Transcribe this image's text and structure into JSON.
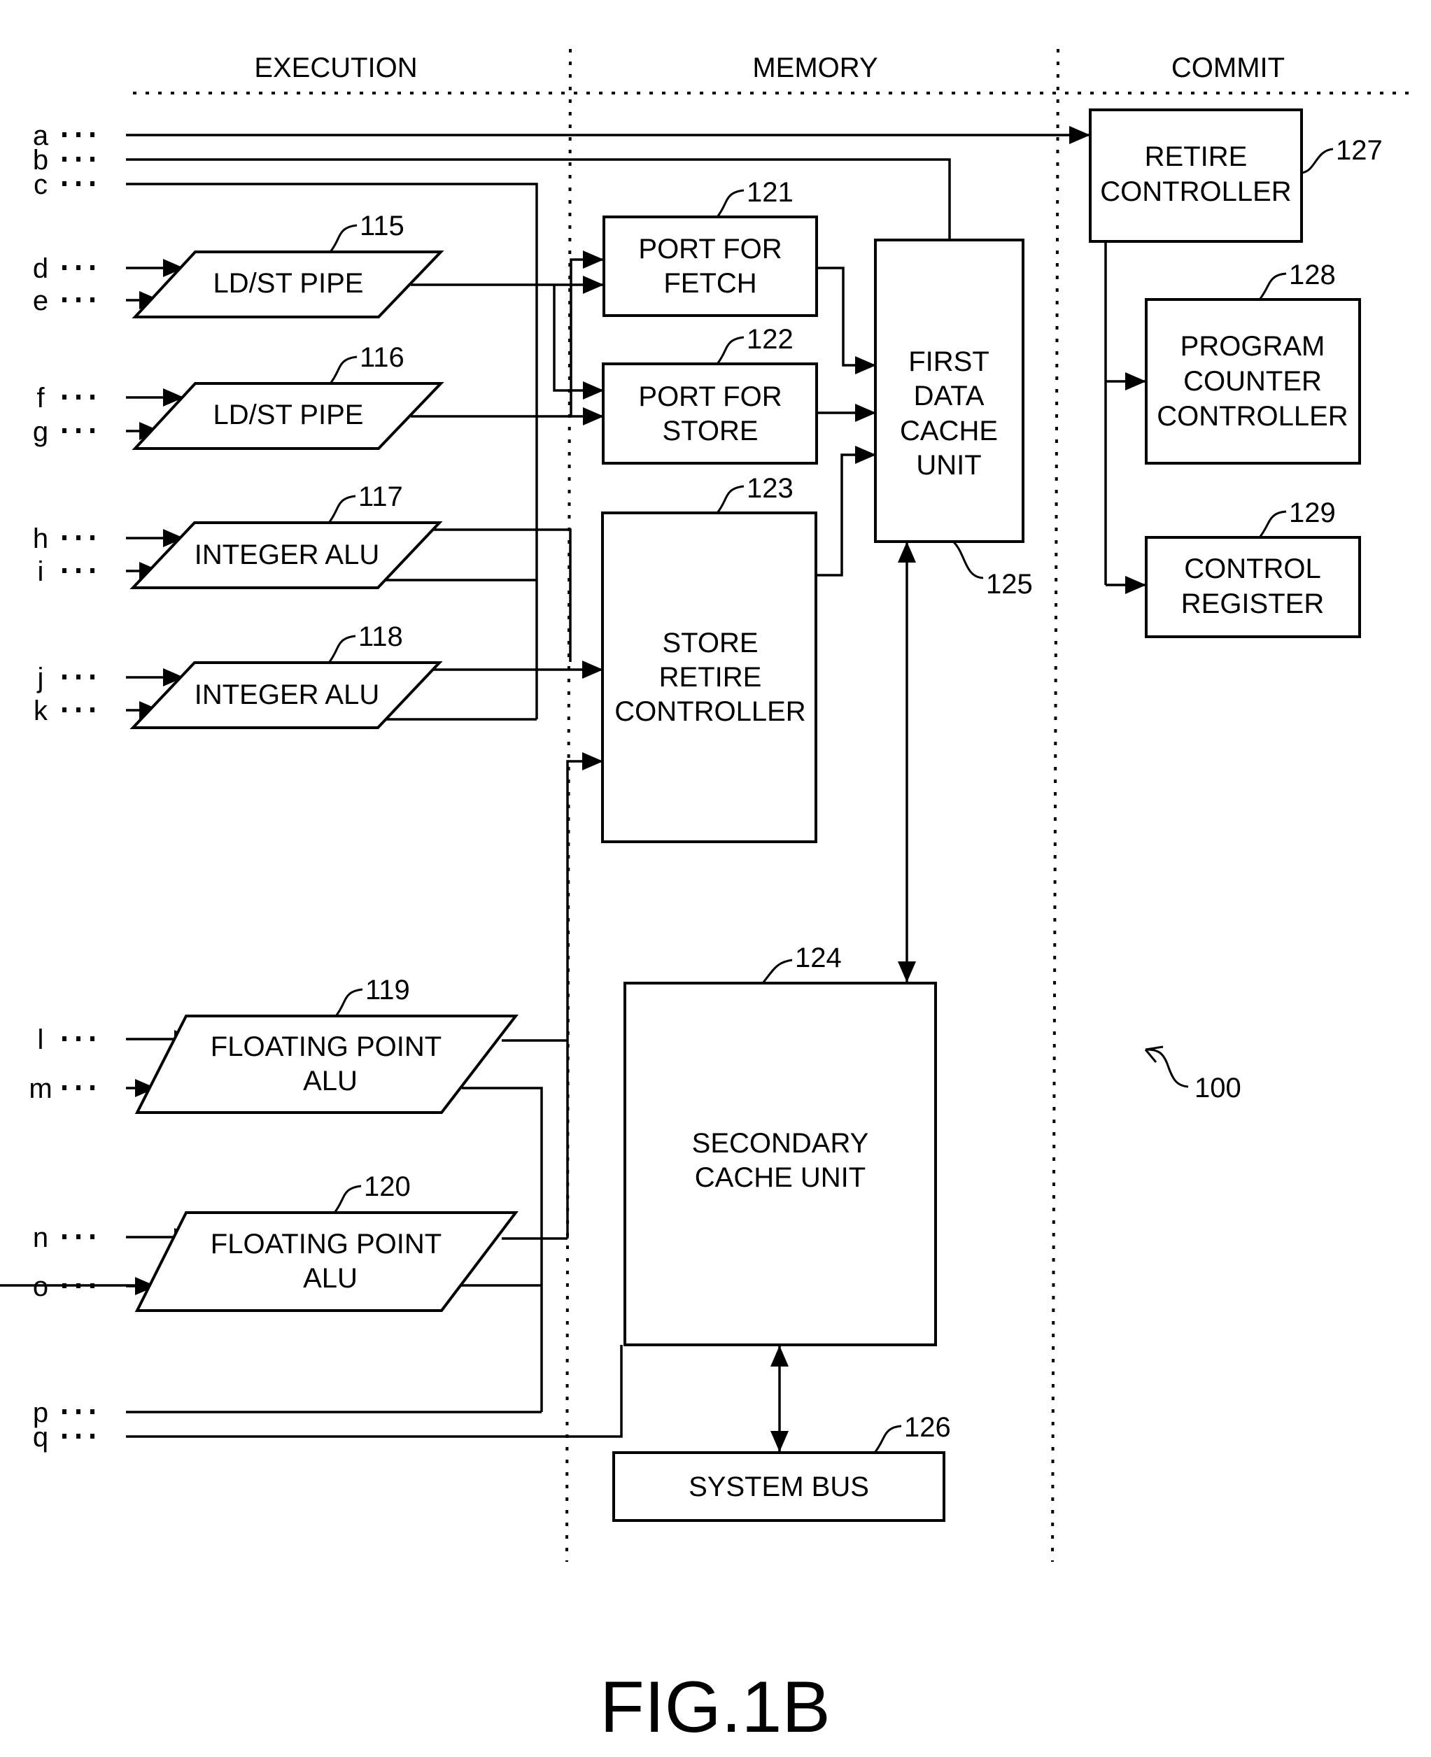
{
  "figure": {
    "title": "FIG.1B",
    "reference_numeral": "100"
  },
  "sections": [
    {
      "id": "execution",
      "label": "EXECUTION"
    },
    {
      "id": "memory",
      "label": "MEMORY"
    },
    {
      "id": "commit",
      "label": "COMMIT"
    }
  ],
  "inputs": [
    {
      "id": "a",
      "label": "a"
    },
    {
      "id": "b",
      "label": "b"
    },
    {
      "id": "c",
      "label": "c"
    },
    {
      "id": "d",
      "label": "d"
    },
    {
      "id": "e",
      "label": "e"
    },
    {
      "id": "f",
      "label": "f"
    },
    {
      "id": "g",
      "label": "g"
    },
    {
      "id": "h",
      "label": "h"
    },
    {
      "id": "i",
      "label": "i"
    },
    {
      "id": "j",
      "label": "j"
    },
    {
      "id": "k",
      "label": "k"
    },
    {
      "id": "l",
      "label": "l"
    },
    {
      "id": "m",
      "label": "m"
    },
    {
      "id": "n",
      "label": "n"
    },
    {
      "id": "o",
      "label": "o"
    },
    {
      "id": "p",
      "label": "p"
    },
    {
      "id": "q",
      "label": "q"
    }
  ],
  "input_ellipsis": "•••",
  "blocks": {
    "ldst_pipe_1": {
      "ref": "115",
      "lines": [
        "LD/ST PIPE"
      ]
    },
    "ldst_pipe_2": {
      "ref": "116",
      "lines": [
        "LD/ST PIPE"
      ]
    },
    "integer_alu_1": {
      "ref": "117",
      "lines": [
        "INTEGER ALU"
      ]
    },
    "integer_alu_2": {
      "ref": "118",
      "lines": [
        "INTEGER ALU"
      ]
    },
    "fp_alu_1": {
      "ref": "119",
      "lines": [
        "FLOATING POINT",
        "ALU"
      ]
    },
    "fp_alu_2": {
      "ref": "120",
      "lines": [
        "FLOATING POINT",
        "ALU"
      ]
    },
    "port_fetch": {
      "ref": "121",
      "lines": [
        "PORT FOR",
        "FETCH"
      ]
    },
    "port_store": {
      "ref": "122",
      "lines": [
        "PORT FOR",
        "STORE"
      ]
    },
    "store_retire_controller": {
      "ref": "123",
      "lines": [
        "STORE",
        "RETIRE",
        "CONTROLLER"
      ]
    },
    "secondary_cache": {
      "ref": "124",
      "lines": [
        "SECONDARY",
        "CACHE UNIT"
      ]
    },
    "first_data_cache": {
      "ref": "125",
      "lines": [
        "FIRST",
        "DATA",
        "CACHE",
        "UNIT"
      ]
    },
    "system_bus": {
      "ref": "126",
      "lines": [
        "SYSTEM BUS"
      ]
    },
    "retire_controller": {
      "ref": "127",
      "lines": [
        "RETIRE",
        "CONTROLLER"
      ]
    },
    "program_counter_controller": {
      "ref": "128",
      "lines": [
        "PROGRAM",
        "COUNTER",
        "CONTROLLER"
      ]
    },
    "control_register": {
      "ref": "129",
      "lines": [
        "CONTROL",
        "REGISTER"
      ]
    }
  }
}
